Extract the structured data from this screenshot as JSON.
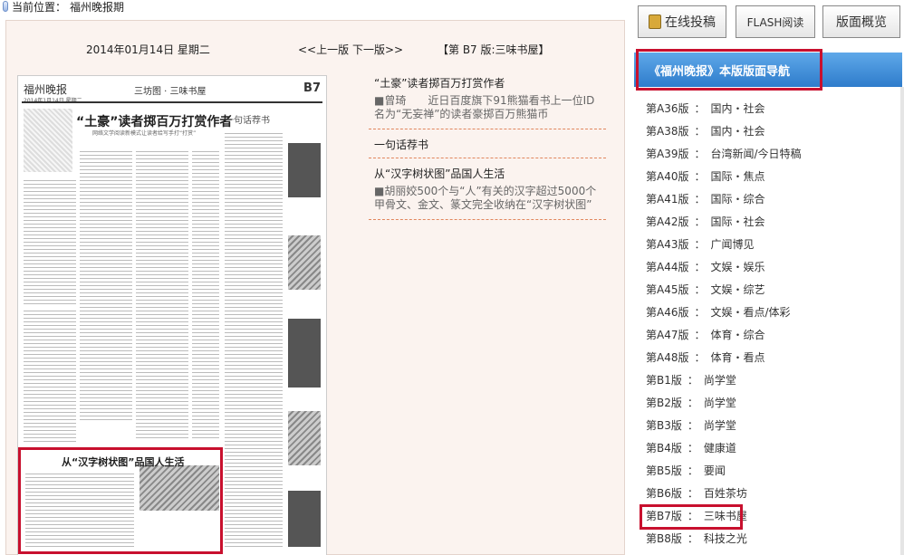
{
  "breadcrumb": {
    "label": "当前位置：",
    "value": "福州晚报期"
  },
  "topbar": {
    "date": "2014年01月14日 星期二",
    "prev": "<<上一版",
    "next": "下一版>>",
    "edition": "【第 B7 版:三味书屋】"
  },
  "paper": {
    "masthead": "福州晚报",
    "mast_date": "2014年1月14日 星期二",
    "section": "三坊图 · 三味书屋",
    "page": "B7",
    "headline": "“土豪”读者掷百万打赏作者",
    "subhead": "网络文学阅读新模式让读者给写手打“打赏”",
    "column": "一句话荐书",
    "bottom_headline": "从“汉字树状图”品国人生活"
  },
  "articles": [
    {
      "title": "“土豪”读者掷百万打赏作者",
      "desc": "■曾琦　　近日百度旗下91熊猫看书上一位ID名为“无妄禅”的读者豪掷百万熊猫币"
    },
    {
      "title": "一句话荐书",
      "desc": ""
    },
    {
      "title": "从“汉字树状图”品国人生活",
      "desc": "■胡丽姣500个与“人”有关的汉字超过5000个甲骨文、金文、篆文完全收纳在“汉字树状图”"
    }
  ],
  "buttons": {
    "submit": "在线投稿",
    "flash": "FLASH阅读",
    "overview": "版面概览"
  },
  "nav": {
    "header": "《福州晚报》本版版面导航",
    "items": [
      {
        "page": "第A36版",
        "name": "国内・社会"
      },
      {
        "page": "第A38版",
        "name": "国内・社会"
      },
      {
        "page": "第A39版",
        "name": "台湾新闻/今日特稿"
      },
      {
        "page": "第A40版",
        "name": "国际・焦点"
      },
      {
        "page": "第A41版",
        "name": "国际・综合"
      },
      {
        "page": "第A42版",
        "name": "国际・社会"
      },
      {
        "page": "第A43版",
        "name": "广闻博见"
      },
      {
        "page": "第A44版",
        "name": "文娱・娱乐"
      },
      {
        "page": "第A45版",
        "name": "文娱・综艺"
      },
      {
        "page": "第A46版",
        "name": "文娱・看点/体彩"
      },
      {
        "page": "第A47版",
        "name": "体育・综合"
      },
      {
        "page": "第A48版",
        "name": "体育・看点"
      },
      {
        "page": "第B1版",
        "name": "尚学堂"
      },
      {
        "page": "第B2版",
        "name": "尚学堂"
      },
      {
        "page": "第B3版",
        "name": "尚学堂"
      },
      {
        "page": "第B4版",
        "name": "健康道"
      },
      {
        "page": "第B5版",
        "name": "要闻"
      },
      {
        "page": "第B6版",
        "name": "百姓茶坊"
      },
      {
        "page": "第B7版",
        "name": "三味书屋"
      },
      {
        "page": "第B8版",
        "name": "科技之光"
      }
    ],
    "separator": "：",
    "active_index": 18
  },
  "colors": {
    "nav_header_bg": "#2e7ccb",
    "highlight_border": "#c8102e",
    "panel_bg": "#fbf3ef",
    "divider": "#e1865d"
  }
}
